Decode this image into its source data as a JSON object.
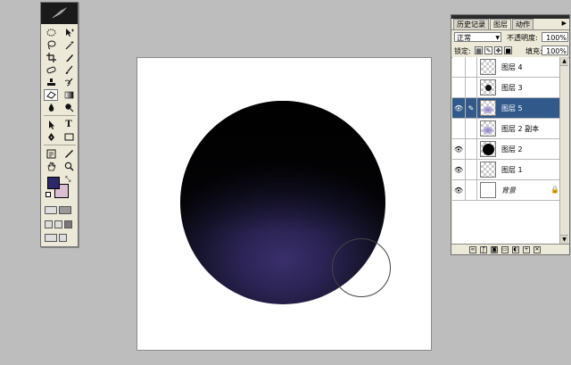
{
  "colors": {
    "foreground": "#2d2869",
    "background": "#d9bfd0",
    "selection": "#31598a",
    "sphere_core": "#3a2f6c"
  },
  "toolbox": {
    "tools": [
      [
        "marquee-icon",
        "move-icon"
      ],
      [
        "lasso-icon",
        "magic-wand-icon"
      ],
      [
        "crop-icon",
        "slice-icon"
      ],
      [
        "healing-brush-icon",
        "brush-icon"
      ],
      [
        "clone-stamp-icon",
        "history-brush-icon"
      ],
      [
        "eraser-icon",
        "gradient-icon"
      ],
      [
        "blur-icon",
        "dodge-icon"
      ],
      [
        "path-select-icon",
        "type-icon"
      ],
      [
        "pen-icon",
        "shape-icon"
      ],
      [
        "notes-icon",
        "eyedropper-icon"
      ],
      [
        "hand-icon",
        "zoom-icon"
      ]
    ],
    "type_glyph": "T"
  },
  "layers_panel": {
    "tabs": [
      "历史记录",
      "图层",
      "动作"
    ],
    "active_tab": "图层",
    "blend_mode": "正常",
    "opacity_label": "不透明度:",
    "opacity_value": "100%",
    "lock_label": "锁定:",
    "fill_label": "填充:",
    "fill_value": "100%",
    "layers": [
      {
        "name": "图层 4",
        "visible": false,
        "selected": false,
        "thumb": "transparent"
      },
      {
        "name": "图层 3",
        "visible": false,
        "selected": false,
        "thumb": "small-dark"
      },
      {
        "name": "图层 5",
        "visible": true,
        "selected": true,
        "thumb": "purple-glow"
      },
      {
        "name": "图层 2 副本",
        "visible": false,
        "selected": false,
        "thumb": "purple-glow"
      },
      {
        "name": "图层 2",
        "visible": true,
        "selected": false,
        "thumb": "black-circle"
      },
      {
        "name": "图层 1",
        "visible": true,
        "selected": false,
        "thumb": "transparent"
      },
      {
        "name": "背景",
        "visible": true,
        "selected": false,
        "thumb": "white",
        "locked": true
      }
    ]
  }
}
